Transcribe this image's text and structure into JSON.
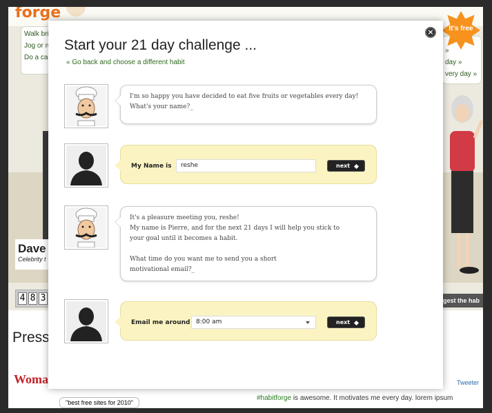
{
  "background": {
    "logo": "forge",
    "left_tasks": [
      "Walk bri",
      "Jog or ru",
      "Do a car"
    ],
    "right_tasks": [
      "»",
      "day »",
      "very day »"
    ],
    "dave_name": "Dave",
    "dave_caption": "Celebrity t",
    "counter_digits": [
      "4",
      "8",
      "3"
    ],
    "press_heading": "Press",
    "womans_logo": "Woman",
    "best_sites": "\"best free sites for 2010\"",
    "suggest_button": "gest the hab",
    "tweet_hashtag": "#habitforge",
    "tweet_text": " is awesome. It motivates me every day. lorem ipsum",
    "tweeter_label": "Tweeter",
    "free_badge": "It's free"
  },
  "modal": {
    "title": "Start your 21 day challenge ...",
    "back_link": "« Go back and choose a different habit",
    "close_label": "×",
    "chef_message_1": [
      "I'm so happy you have decided to eat five fruits or vegetables every day!",
      "What's your name?_"
    ],
    "name_form": {
      "label": "My Name is",
      "value": "reshe",
      "next_label": "next"
    },
    "chef_message_2": [
      "It's a pleasure meeting you, reshe!",
      "My name is Pierre, and for the next 21 days I will help you stick to",
      "your goal until it becomes a habit.",
      "",
      "What time do you want me to send you a short",
      "motivational email?_"
    ],
    "email_form": {
      "label": "Email me around",
      "selected_time": "8:00 am",
      "next_label": "next"
    }
  },
  "colors": {
    "form_bg": "#fbf4c2",
    "link_green": "#2d6a1c",
    "badge_orange": "#f7921e"
  }
}
